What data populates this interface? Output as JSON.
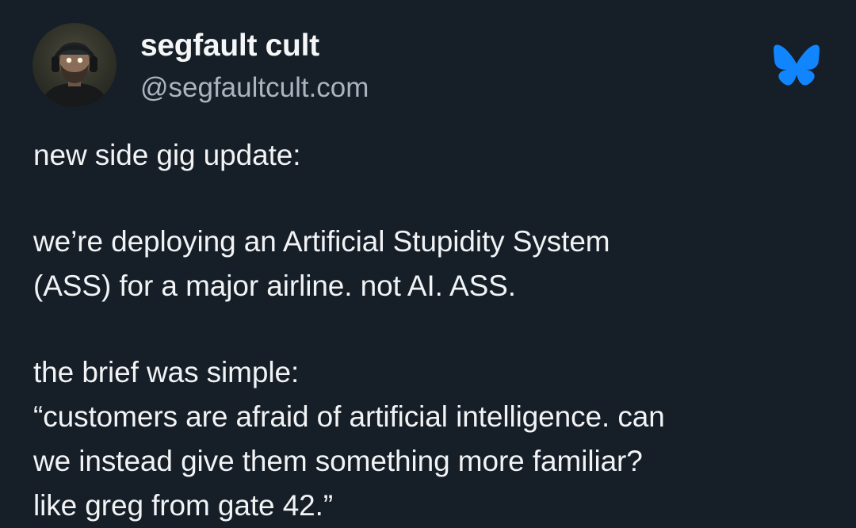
{
  "post": {
    "author": {
      "display_name": "segfault cult",
      "handle": "@segfaultcult.com",
      "avatar_icon": "user-avatar"
    },
    "platform_icon": "bluesky-butterfly-icon",
    "accent_color": "#1185fe",
    "text": {
      "paragraph1": [
        "new side gig update:"
      ],
      "paragraph2": [
        "we’re deploying an Artificial Stupidity System",
        "(ASS) for a major airline. not AI. ASS."
      ],
      "paragraph3": [
        "the brief was simple:",
        "“customers are afraid of artificial intelligence. can",
        "we instead give them something more familiar?",
        "like greg from gate 42.”"
      ]
    }
  }
}
